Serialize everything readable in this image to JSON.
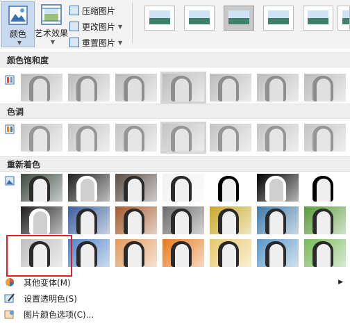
{
  "ribbon": {
    "color_label": "颜色",
    "art_label": "艺术效果",
    "compress_label": "压缩图片",
    "change_label": "更改图片",
    "reset_label": "重置图片"
  },
  "sections": {
    "saturation": "颜色饱和度",
    "tone": "色调",
    "recolor": "重新着色"
  },
  "menu": {
    "variants": "其他变体(M)",
    "transparent": "设置透明色(S)",
    "options": "图片颜色选项(C)..."
  },
  "recolor_colors": [
    [
      "#3c4a40",
      "#202020",
      "#5a4e44",
      "#f2f2f2",
      "#ffffff",
      "#000000",
      "#ffffff"
    ],
    [
      "#1c1c1c",
      "#3b5f9c",
      "#a45a2c",
      "#6a6a6a",
      "#c8a82a",
      "#3f7aa8",
      "#5a9a3c"
    ],
    [
      "#bfbfbf",
      "#5083c8",
      "#e39a5e",
      "#e67a1e",
      "#e7c96c",
      "#5a98c8",
      "#78b85a"
    ]
  ]
}
